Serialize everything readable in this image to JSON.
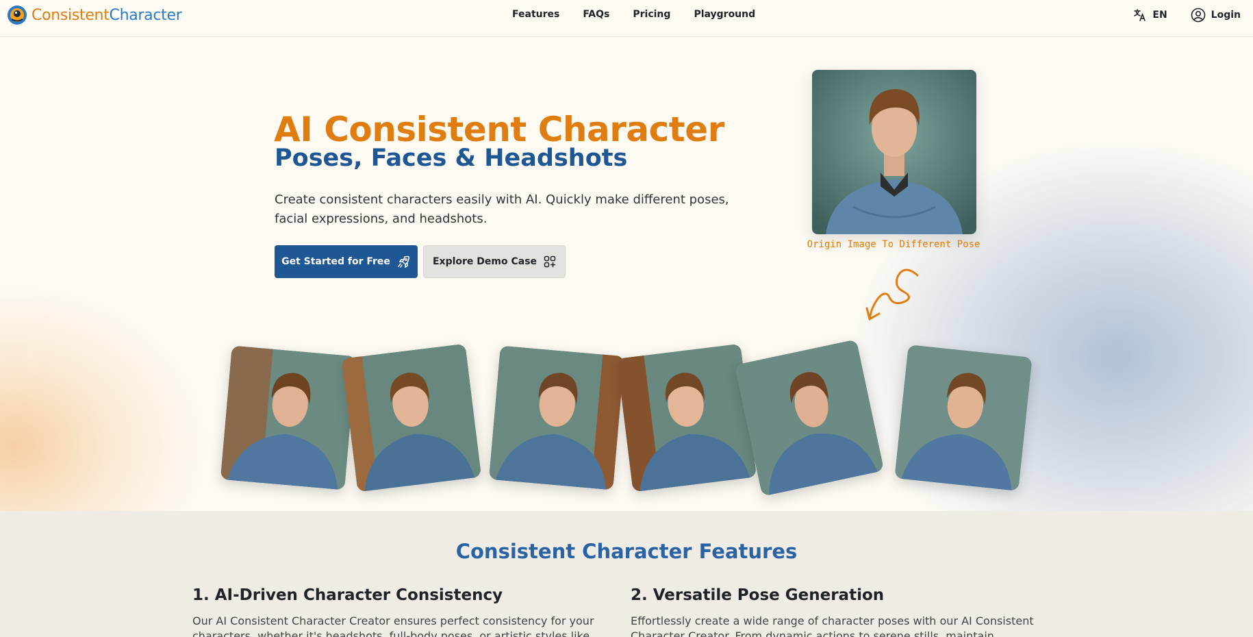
{
  "brand": {
    "name_part1": "Consistent",
    "name_part2": "Character"
  },
  "nav": {
    "links": [
      "Features",
      "FAQs",
      "Pricing",
      "Playground"
    ],
    "language": "EN",
    "login": "Login"
  },
  "hero": {
    "title": "AI Consistent Character",
    "subtitle": "Poses, Faces & Headshots",
    "description": "Create consistent characters easily with AI. Quickly make different poses, facial expressions, and headshots.",
    "primary_button": "Get Started for Free",
    "secondary_button": "Explore Demo Case",
    "origin_caption": "Origin Image To Different Pose"
  },
  "features": {
    "title": "Consistent Character Features",
    "items": [
      {
        "title": "1. AI-Driven Character Consistency",
        "text": "Our AI Consistent Character Creator ensures perfect consistency for your characters, whether it's headshots, full-body poses, or artistic styles like oil"
      },
      {
        "title": "2. Versatile Pose Generation",
        "text": "Effortlessly create a wide range of character poses with our AI Consistent Character Creator. From dynamic actions to serene stills, maintain consistent visuals across all"
      }
    ]
  },
  "colors": {
    "accent_orange": "#e07d10",
    "brand_blue": "#1f5694",
    "page_bg": "#fdfaf3"
  }
}
